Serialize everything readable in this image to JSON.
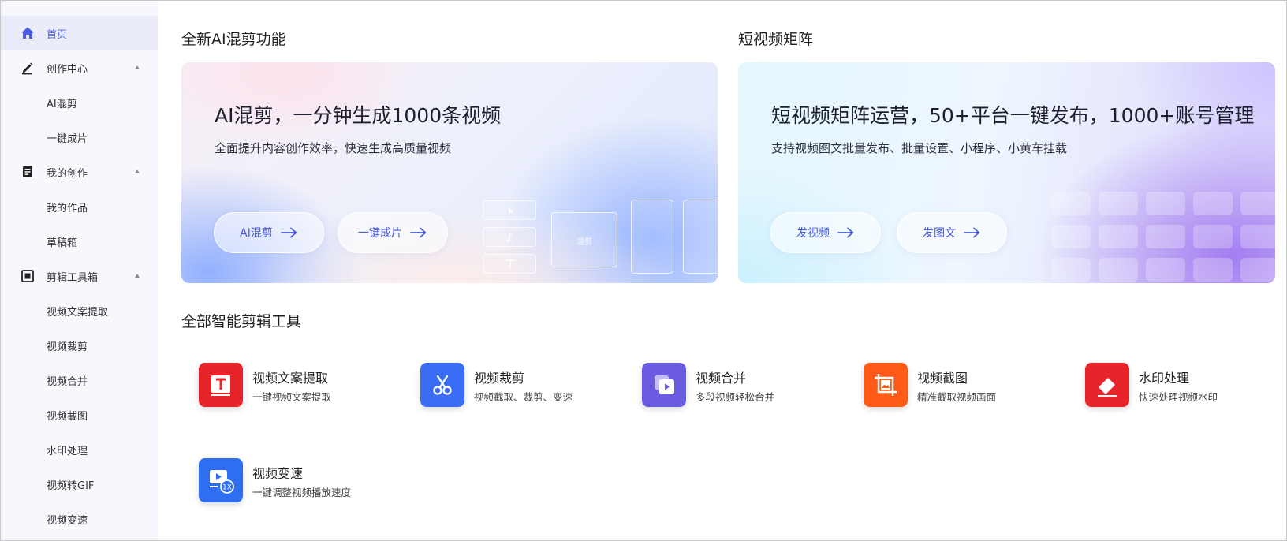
{
  "sidebar": {
    "items": [
      {
        "label": "首页",
        "icon": "home-icon",
        "active": true
      },
      {
        "label": "创作中心",
        "icon": "pen-icon",
        "expandable": true
      },
      {
        "label": "AI混剪",
        "sub": true
      },
      {
        "label": "一键成片",
        "sub": true
      },
      {
        "label": "我的创作",
        "icon": "document-icon",
        "expandable": true
      },
      {
        "label": "我的作品",
        "sub": true
      },
      {
        "label": "草稿箱",
        "sub": true
      },
      {
        "label": "剪辑工具箱",
        "icon": "toolbox-icon",
        "expandable": true
      },
      {
        "label": "视频文案提取",
        "sub": true
      },
      {
        "label": "视频裁剪",
        "sub": true
      },
      {
        "label": "视频合并",
        "sub": true
      },
      {
        "label": "视频截图",
        "sub": true
      },
      {
        "label": "水印处理",
        "sub": true
      },
      {
        "label": "视频转GIF",
        "sub": true
      },
      {
        "label": "视频变速",
        "sub": true
      }
    ]
  },
  "sections": {
    "ai_mix_title": "全新AI混剪功能",
    "matrix_title": "短视频矩阵",
    "tools_title": "全部智能剪辑工具"
  },
  "banner_ai": {
    "title": "AI混剪，一分钟生成1000条视频",
    "subtitle": "全面提升内容创作效率，快速生成高质量视频",
    "btn1": "AI混剪",
    "btn2": "一键成片",
    "mock_label": "混剪"
  },
  "banner_matrix": {
    "title": "短视频矩阵运营，50+平台一键发布，1000+账号管理",
    "subtitle": "支持视频图文批量发布、批量设置、小程序、小黄车挂载",
    "btn1": "发视频",
    "btn2": "发图文"
  },
  "tools": [
    {
      "name": "视频文案提取",
      "desc": "一键视频文案提取",
      "icon": "text-extract-icon",
      "color": "#e8242b"
    },
    {
      "name": "视频裁剪",
      "desc": "视频截取、裁剪、变速",
      "icon": "scissors-icon",
      "color": "#3a6cf4"
    },
    {
      "name": "视频合并",
      "desc": "多段视频轻松合并",
      "icon": "video-merge-icon",
      "color": "#6a5be0"
    },
    {
      "name": "视频截图",
      "desc": "精准截取视频画面",
      "icon": "screenshot-icon",
      "color": "#ff5a17"
    },
    {
      "name": "水印处理",
      "desc": "快速处理视频水印",
      "icon": "eraser-icon",
      "color": "#e8242b"
    },
    {
      "name": "视频变速",
      "desc": "一键调整视频播放速度",
      "icon": "speed-icon",
      "color": "#2f6ef0"
    }
  ]
}
